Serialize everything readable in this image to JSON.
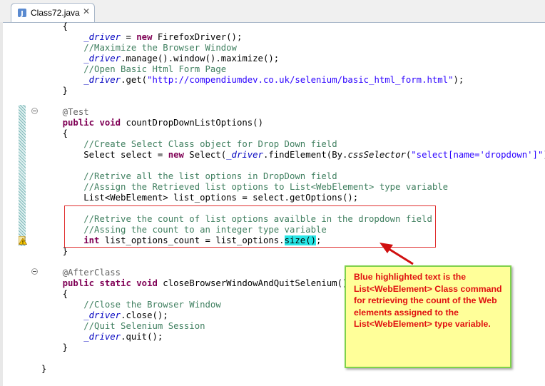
{
  "editor": {
    "tab": {
      "title": "Class72.java",
      "close_symbol": "✕",
      "icon": "java-file-icon"
    },
    "lines": [
      [
        [
          "pl",
          "    {"
        ]
      ],
      [
        [
          "pl",
          "        "
        ],
        [
          "fld",
          "_driver"
        ],
        [
          "pl",
          " = "
        ],
        [
          "kw",
          "new"
        ],
        [
          "pl",
          " FirefoxDriver();"
        ]
      ],
      [
        [
          "pl",
          "        "
        ],
        [
          "cm",
          "//Maximize the Browser Window"
        ]
      ],
      [
        [
          "pl",
          "        "
        ],
        [
          "fld",
          "_driver"
        ],
        [
          "pl",
          ".manage().window().maximize();"
        ]
      ],
      [
        [
          "pl",
          "        "
        ],
        [
          "cm",
          "//Open Basic Html Form Page"
        ]
      ],
      [
        [
          "pl",
          "        "
        ],
        [
          "fld",
          "_driver"
        ],
        [
          "pl",
          ".get("
        ],
        [
          "str",
          "\"http://compendiumdev.co.uk/selenium/basic_html_form.html\""
        ],
        [
          "pl",
          ");"
        ]
      ],
      [
        [
          "pl",
          "    }"
        ]
      ],
      [
        [
          "pl",
          ""
        ]
      ],
      [
        [
          "pl",
          "    "
        ],
        [
          "ann",
          "@Test"
        ]
      ],
      [
        [
          "pl",
          "    "
        ],
        [
          "kw",
          "public"
        ],
        [
          "pl",
          " "
        ],
        [
          "kw",
          "void"
        ],
        [
          "pl",
          " countDropDownListOptions()"
        ]
      ],
      [
        [
          "pl",
          "    {"
        ]
      ],
      [
        [
          "pl",
          "        "
        ],
        [
          "cm",
          "//Create Select Class object for Drop Down field"
        ]
      ],
      [
        [
          "pl",
          "        Select select = "
        ],
        [
          "kw",
          "new"
        ],
        [
          "pl",
          " Select("
        ],
        [
          "fld",
          "_driver"
        ],
        [
          "pl",
          ".findElement(By."
        ],
        [
          "st",
          "cssSelector"
        ],
        [
          "pl",
          "("
        ],
        [
          "str",
          "\"select[name='dropdown']\""
        ],
        [
          "pl",
          ")));"
        ]
      ],
      [
        [
          "pl",
          ""
        ]
      ],
      [
        [
          "pl",
          "        "
        ],
        [
          "cm",
          "//Retrive all the list options in DropDown field"
        ]
      ],
      [
        [
          "pl",
          "        "
        ],
        [
          "cm",
          "//Assign the Retrieved list options to List<WebElement> type variable"
        ]
      ],
      [
        [
          "pl",
          "        List<WebElement> list_options = select.getOptions();"
        ]
      ],
      [
        [
          "pl",
          ""
        ]
      ],
      [
        [
          "pl",
          "        "
        ],
        [
          "cm",
          "//Retrive the count of list options availble in the dropdown field"
        ]
      ],
      [
        [
          "pl",
          "        "
        ],
        [
          "cm",
          "//Assing the count to an integer type variable"
        ]
      ],
      [
        [
          "pl",
          "        "
        ],
        [
          "kw",
          "int"
        ],
        [
          "pl",
          " list_options_count = list_options."
        ],
        [
          "hl",
          "size()"
        ],
        [
          "pl",
          ";"
        ]
      ],
      [
        [
          "pl",
          "    }"
        ]
      ],
      [
        [
          "pl",
          ""
        ]
      ],
      [
        [
          "pl",
          "    "
        ],
        [
          "ann",
          "@AfterClass"
        ]
      ],
      [
        [
          "pl",
          "    "
        ],
        [
          "kw",
          "public"
        ],
        [
          "pl",
          " "
        ],
        [
          "kw",
          "static"
        ],
        [
          "pl",
          " "
        ],
        [
          "kw",
          "void"
        ],
        [
          "pl",
          " closeBrowserWindowAndQuitSelenium()"
        ]
      ],
      [
        [
          "pl",
          "    {"
        ]
      ],
      [
        [
          "pl",
          "        "
        ],
        [
          "cm",
          "//Close the Browser Window"
        ]
      ],
      [
        [
          "pl",
          "        "
        ],
        [
          "fld",
          "_driver"
        ],
        [
          "pl",
          ".close();"
        ]
      ],
      [
        [
          "pl",
          "        "
        ],
        [
          "cm",
          "//Quit Selenium Session"
        ]
      ],
      [
        [
          "pl",
          "        "
        ],
        [
          "fld",
          "_driver"
        ],
        [
          "pl",
          ".quit();"
        ]
      ],
      [
        [
          "pl",
          "    }"
        ]
      ],
      [
        [
          "pl",
          ""
        ]
      ],
      [
        [
          "pl",
          "}"
        ]
      ]
    ]
  },
  "annotation": {
    "note_text": "Blue highlighted text is the List<WebElement> Class command for retrieving the count of the Web elements assigned to the List<WebElement> type variable.",
    "note_text_color": "#e01010",
    "note_background": "#ffff99",
    "note_border_color": "#7fd24a",
    "box_color": "#e03030",
    "arrow_color": "#e01010"
  },
  "gutter": {
    "warning_icon": "warning-icon",
    "fold_icon": "fold-collapse-icon"
  }
}
